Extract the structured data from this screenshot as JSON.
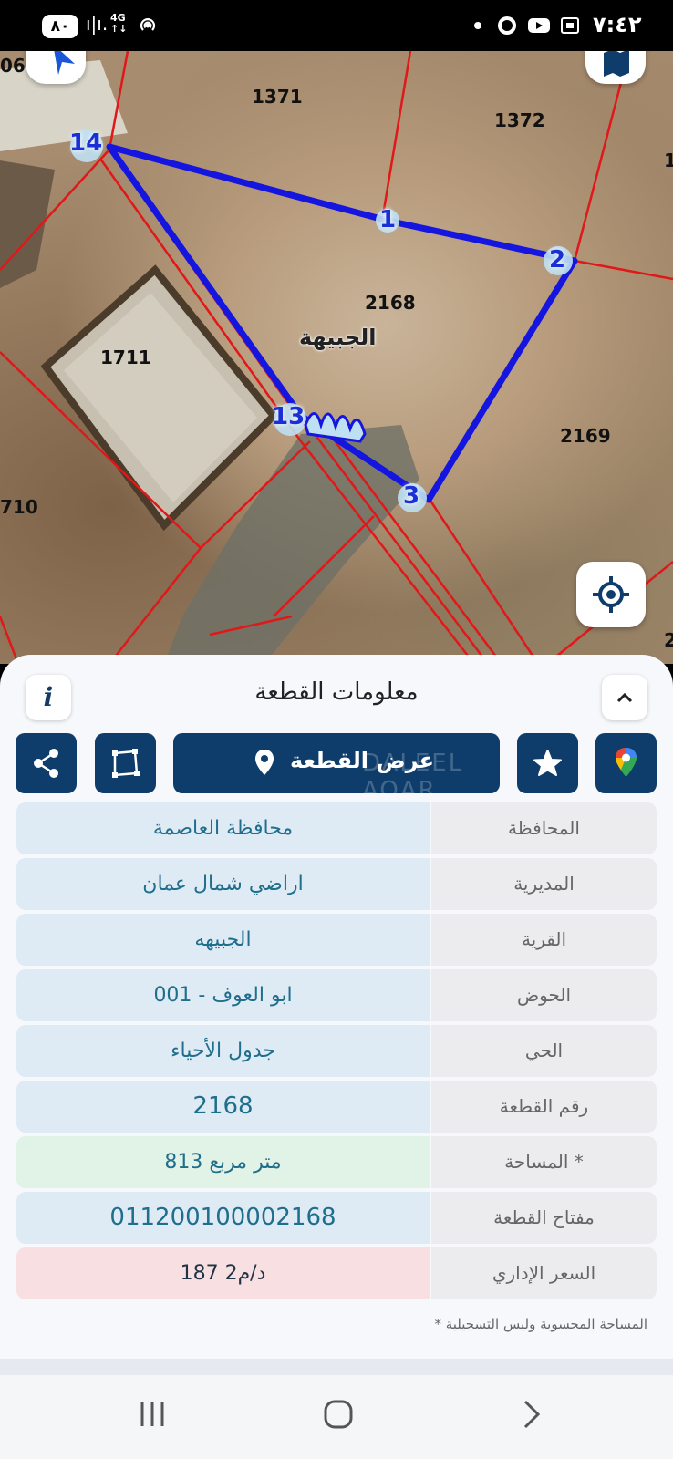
{
  "status_bar": {
    "battery": "٨٠",
    "network_type": "4G",
    "time": "٧:٤٢"
  },
  "map": {
    "parcel_numbers": [
      "1371",
      "1372",
      "2168",
      "1711",
      "2169",
      "710",
      "06",
      "1",
      "2"
    ],
    "village_name": "الجبيهة",
    "vertices": [
      "14",
      "1",
      "2",
      "3",
      "13"
    ],
    "boundary_color": "#1515e0",
    "cadastre_line_color": "#e0181a"
  },
  "panel": {
    "title": "معلومات القطعة",
    "show_parcel_label": "عرض القطعة",
    "watermark": "DALEEL AQAR",
    "accent_color": "#0f3d6b",
    "rows": [
      {
        "key": "المحافظة",
        "value": "محافظة العاصمة"
      },
      {
        "key": "المديرية",
        "value": "اراضي شمال عمان"
      },
      {
        "key": "القرية",
        "value": "الجبيهه"
      },
      {
        "key": "الحوض",
        "value": "ابو العوف - 001"
      },
      {
        "key": "الحي",
        "value": "جدول الأحياء"
      },
      {
        "key": "رقم القطعة",
        "value": "2168"
      },
      {
        "key": "المساحة *",
        "value": "813  متر مربع"
      },
      {
        "key": "مفتاح القطعة",
        "value": "011200100002168"
      },
      {
        "key": "السعر الإداري",
        "value": "187 د/م2"
      }
    ],
    "footnote": "* المساحة المحسوبة وليس التسجيلية"
  }
}
